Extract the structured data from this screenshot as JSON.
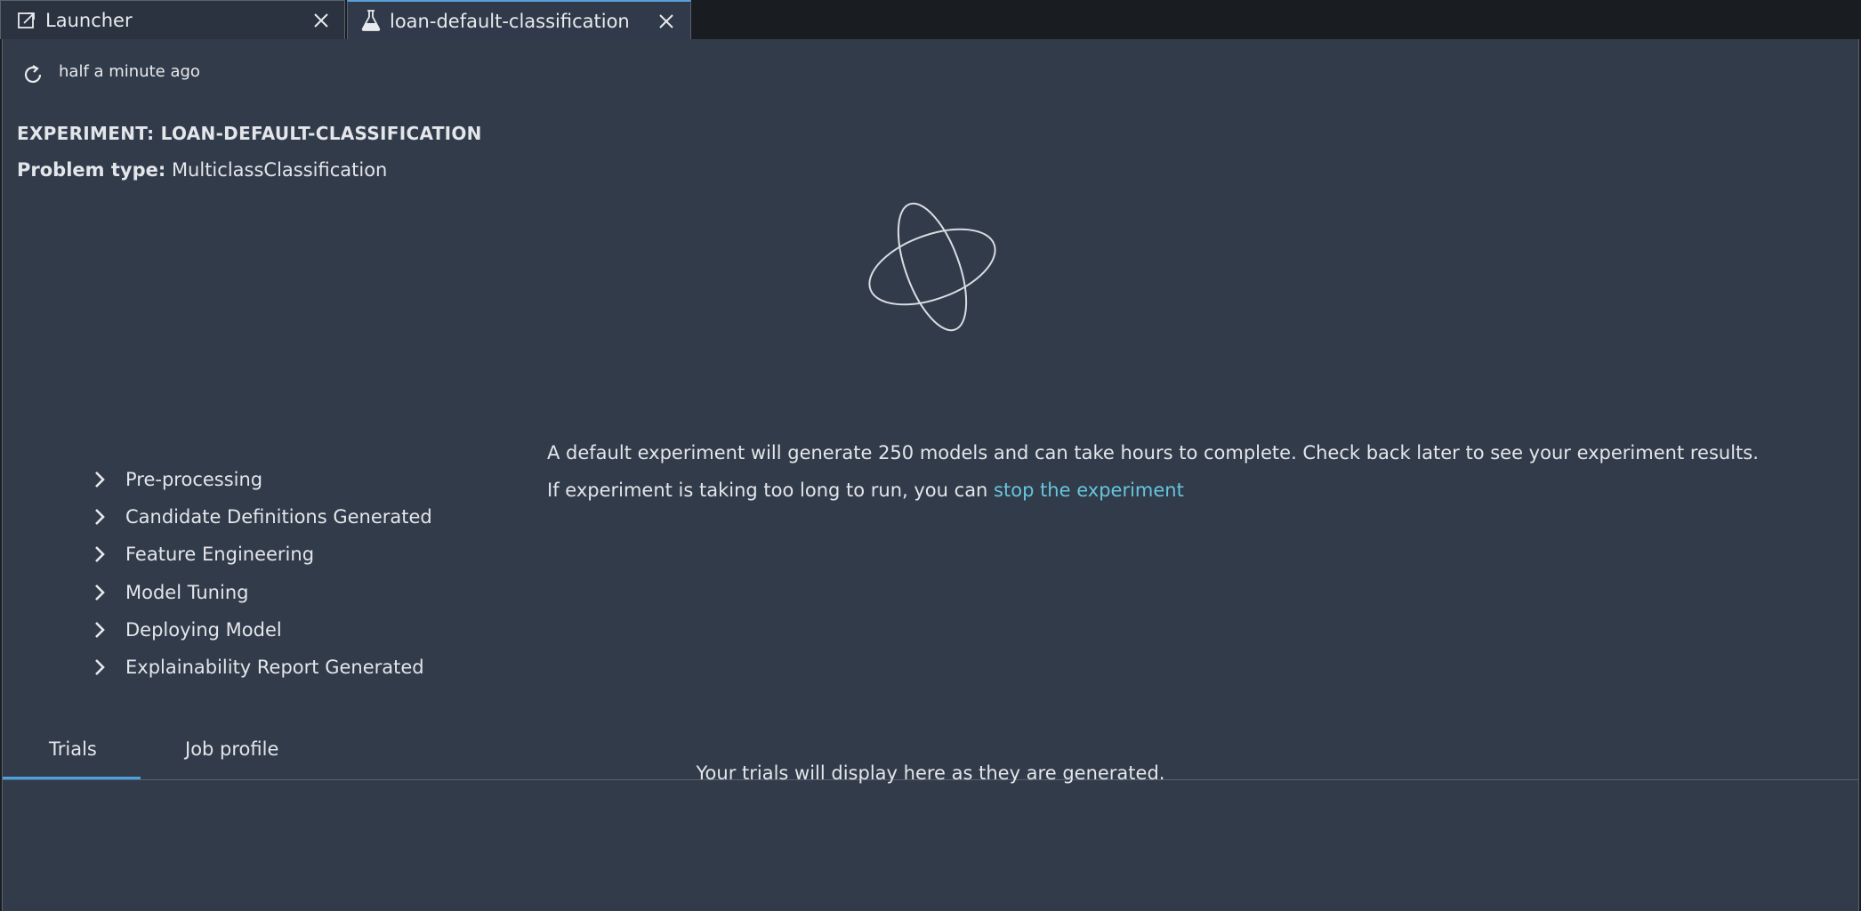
{
  "tabs": [
    {
      "label": "Launcher",
      "icon": "external-link-icon",
      "active": false
    },
    {
      "label": "loan-default-classification",
      "icon": "flask-icon",
      "active": true
    }
  ],
  "refresh": {
    "icon": "refresh-icon",
    "text": "half a minute ago"
  },
  "experiment": {
    "title": "EXPERIMENT: LOAN-DEFAULT-CLASSIFICATION",
    "problem_label": "Problem type:",
    "problem_value": "MulticlassClassification"
  },
  "steps": [
    {
      "label": "Pre-processing"
    },
    {
      "label": "Candidate Definitions Generated"
    },
    {
      "label": "Feature Engineering"
    },
    {
      "label": "Model Tuning"
    },
    {
      "label": "Deploying Model"
    },
    {
      "label": "Explainability Report Generated"
    }
  ],
  "info": {
    "line1": "A default experiment will generate 250 models and can take hours to complete. Check back later to see your experiment results.",
    "line2_prefix": "If experiment is taking too long to run, you can ",
    "line2_link": "stop the experiment"
  },
  "bottom_tabs": [
    {
      "label": "Trials",
      "active": true
    },
    {
      "label": "Job profile",
      "active": false
    }
  ],
  "empty_message": "Your trials will display here as they are generated.",
  "colors": {
    "background": "#323b4a",
    "link": "#66c5dd",
    "tab_accent": "#4aa3df"
  }
}
